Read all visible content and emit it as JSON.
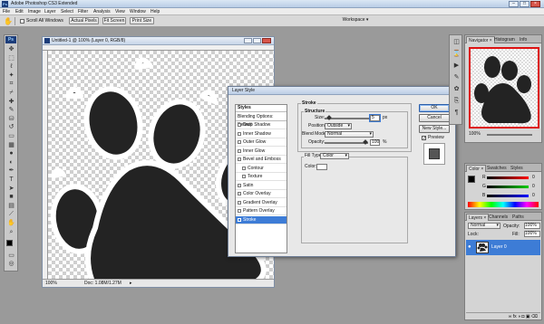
{
  "app": {
    "title": "Adobe Photoshop CS3 Extended",
    "logo": "Ps",
    "window_buttons": [
      "–",
      "□",
      "×"
    ]
  },
  "menu": [
    "File",
    "Edit",
    "Image",
    "Layer",
    "Select",
    "Filter",
    "Analysis",
    "View",
    "Window",
    "Help"
  ],
  "options_bar": {
    "scroll_all_windows": "Scroll All Windows",
    "actual_pixels": "Actual Pixels",
    "fit_screen": "Fit Screen",
    "print_size": "Print Size",
    "workspace": "Workspace ▾"
  },
  "toolbox": {
    "header": "Ps",
    "tools": [
      "move-icon",
      "marquee-icon",
      "lasso-icon",
      "magic-wand-icon",
      "crop-icon",
      "slice-icon",
      "healing-icon",
      "brush-icon",
      "stamp-icon",
      "history-brush-icon",
      "eraser-icon",
      "gradient-icon",
      "blur-icon",
      "dodge-icon",
      "pen-icon",
      "type-icon",
      "path-select-icon",
      "shape-icon",
      "notes-icon",
      "eyedropper-icon",
      "hand-icon",
      "zoom-icon"
    ],
    "tool_glyphs": [
      "✥",
      "⬚",
      "ℓ",
      "✦",
      "⌗",
      "⌿",
      "✚",
      "✎",
      "⛁",
      "↺",
      "▭",
      "▦",
      "●",
      "◐",
      "✒",
      "T",
      "➤",
      "■",
      "▤",
      "⟋",
      "✋",
      "⌕"
    ],
    "mode_glyphs": [
      "▭",
      "◎",
      "⬜"
    ]
  },
  "document": {
    "title": "Untitled-1 @ 100% (Layer 0, RGB/8)",
    "zoom": "100%",
    "doc_info": "Doc: 1.08M/1.27M"
  },
  "layer_style": {
    "title": "Layer Style",
    "styles_header": "Styles",
    "blending_options": "Blending Options: Default",
    "items": [
      {
        "label": "Drop Shadow",
        "checked": false,
        "indent": false
      },
      {
        "label": "Inner Shadow",
        "checked": false,
        "indent": false
      },
      {
        "label": "Outer Glow",
        "checked": false,
        "indent": false
      },
      {
        "label": "Inner Glow",
        "checked": false,
        "indent": false
      },
      {
        "label": "Bevel and Emboss",
        "checked": false,
        "indent": false
      },
      {
        "label": "Contour",
        "checked": false,
        "indent": true
      },
      {
        "label": "Texture",
        "checked": false,
        "indent": true
      },
      {
        "label": "Satin",
        "checked": false,
        "indent": false
      },
      {
        "label": "Color Overlay",
        "checked": false,
        "indent": false
      },
      {
        "label": "Gradient Overlay",
        "checked": false,
        "indent": false
      },
      {
        "label": "Pattern Overlay",
        "checked": false,
        "indent": false
      },
      {
        "label": "Stroke",
        "checked": true,
        "indent": false,
        "selected": true
      }
    ],
    "section_title": "Stroke",
    "structure_title": "Structure",
    "size_label": "Size:",
    "size_value": "5",
    "size_unit": "px",
    "position_label": "Position:",
    "position_value": "Outside",
    "blend_mode_label": "Blend Mode:",
    "blend_mode_value": "Normal",
    "opacity_label": "Opacity:",
    "opacity_value": "100",
    "opacity_unit": "%",
    "fill_type_label": "Fill Type:",
    "fill_type_value": "Color",
    "color_label": "Color:",
    "buttons": {
      "ok": "OK",
      "cancel": "Cancel",
      "new_style": "New Style...",
      "preview": "Preview"
    },
    "preview_checked": true
  },
  "panels": {
    "navigator_tabs": [
      "Navigator ×",
      "Histogram",
      "Info"
    ],
    "nav_zoom": "100%",
    "color_tabs": [
      "Color ×",
      "Swatches",
      "Styles"
    ],
    "color_channels": [
      "R",
      "G",
      "B"
    ],
    "color_values": [
      "0",
      "0",
      "0"
    ],
    "layers_tabs": [
      "Layers ×",
      "Channels",
      "Paths"
    ],
    "blend_mode": "Normal",
    "opacity_label": "Opacity:",
    "opacity_value": "100%",
    "lock_label": "Lock:",
    "fill_label": "Fill:",
    "fill_value": "100%",
    "layer_name": "Layer 0",
    "layer_footer_icons": "∞  fx  ◑  ◘  ▣  ⌫"
  },
  "dock_icons": [
    "navigator-icon",
    "history-icon",
    "actions-icon",
    "tool-presets-icon",
    "brushes-icon",
    "clone-source-icon",
    "paragraph-icon"
  ],
  "dock_glyphs": [
    "◫",
    "⌛",
    "▶",
    "✎",
    "✿",
    "⎘",
    "¶"
  ],
  "colors": {
    "accent": "#3d7cd6",
    "paw": "#232323",
    "workspace": "#9a9a9a"
  }
}
